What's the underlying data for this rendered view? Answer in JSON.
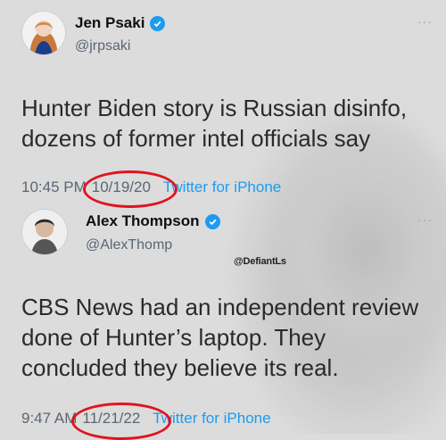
{
  "tweet1": {
    "name": "Jen Psaki",
    "handle": "@jrpsaki",
    "text_line1": "Hunter Biden story is Russian disinfo,",
    "text_line2": "dozens of former intel officials say",
    "time": "10:45 PM",
    "date": "10/19/20",
    "source": "Twitter for iPhone",
    "more": "···"
  },
  "tweet2": {
    "name": "Alex Thompson",
    "handle": "@AlexThomp",
    "text_line1": "CBS News had an independent review",
    "text_line2": "done of Hunter’s laptop. They",
    "text_line3": "concluded they believe its real.",
    "time": "9:47 AM",
    "date": "11/21/22",
    "source": "Twitter for iPhone",
    "more": "···"
  },
  "watermark": "@DefiantLs",
  "colors": {
    "verified": "#1d9bf0",
    "circle": "#e0141e",
    "link": "#1d9bf0"
  },
  "icons": [
    "verified-badge-icon",
    "more-options-icon"
  ]
}
